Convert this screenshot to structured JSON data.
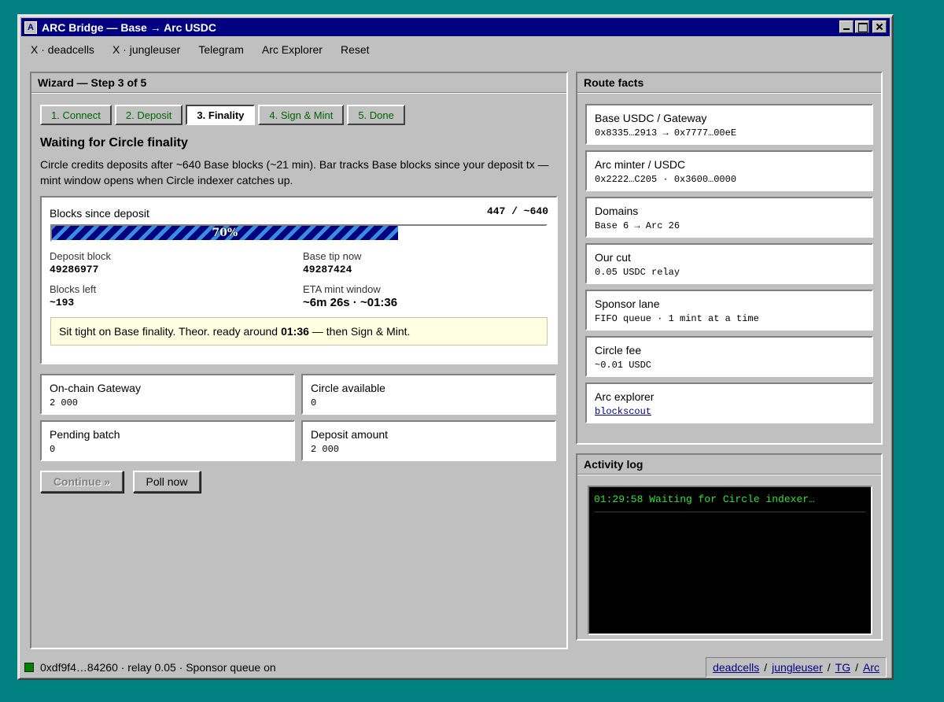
{
  "window": {
    "title": "ARC Bridge — Base → Arc USDC",
    "icon_letter": "A"
  },
  "menu": [
    "X · deadcells",
    "X · jungleuser",
    "Telegram",
    "Arc Explorer",
    "Reset"
  ],
  "wizard": {
    "header": "Wizard — Step 3 of 5",
    "steps": [
      "1. Connect",
      "2. Deposit",
      "3. Finality",
      "4. Sign & Mint",
      "5. Done"
    ],
    "active_step": 3,
    "heading": "Waiting for Circle finality",
    "description": "Circle credits deposits after ~640 Base blocks (~21 min). Bar tracks Base blocks since your deposit tx — mint window opens when Circle indexer catches up.",
    "blocks": {
      "label": "Blocks since deposit",
      "count": "447 / ~640",
      "progress": 0.7,
      "progress_label": "70%",
      "deposit_block_label": "Deposit block",
      "deposit_block": "49286977",
      "base_tip_label": "Base tip now",
      "base_tip": "49287424",
      "blocks_left_label": "Blocks left",
      "blocks_left": "~193",
      "eta_label": "ETA mint window",
      "eta": "~6m 26s · ~01:36",
      "notice_pre": "Sit tight on Base finality. Theor. ready around ",
      "notice_time": "01:36",
      "notice_post": " — then Sign & Mint."
    },
    "stats": {
      "gateway_label": "On-chain Gateway",
      "gateway": "2 000",
      "circle_label": "Circle available",
      "circle": "0",
      "pending_label": "Pending batch",
      "pending": "0",
      "deposit_label": "Deposit amount",
      "deposit": "2 000"
    },
    "buttons": {
      "continue": "Continue »",
      "poll": "Poll now"
    }
  },
  "route": {
    "header": "Route facts",
    "facts": [
      {
        "label": "Base USDC / Gateway",
        "value": "0x8335…2913 → 0x7777…00eE"
      },
      {
        "label": "Arc minter / USDC",
        "value": "0x2222…C205 · 0x3600…0000"
      },
      {
        "label": "Domains",
        "value": "Base 6 → Arc 26"
      },
      {
        "label": "Our cut",
        "value": "0.05 USDC relay"
      },
      {
        "label": "Sponsor lane",
        "value": "FIFO queue · 1 mint at a time"
      },
      {
        "label": "Circle fee",
        "value": "~0.01 USDC"
      },
      {
        "label": "Arc explorer",
        "value": "blockscout"
      }
    ]
  },
  "activity": {
    "header": "Activity log",
    "lines": [
      "01:29:58 Waiting for Circle indexer…"
    ]
  },
  "status": {
    "left": "0xdf9f4…84260 · relay 0.05 · Sponsor queue on",
    "links": [
      "deadcells",
      "jungleuser",
      "TG",
      "Arc"
    ],
    "sep": "/",
    "led_color": "#008000"
  },
  "colors": {
    "desktop": "#008080",
    "titlebar": "#000080",
    "face": "#c0c0c0",
    "step_text": "#006400",
    "console_text": "#2fe03a"
  }
}
